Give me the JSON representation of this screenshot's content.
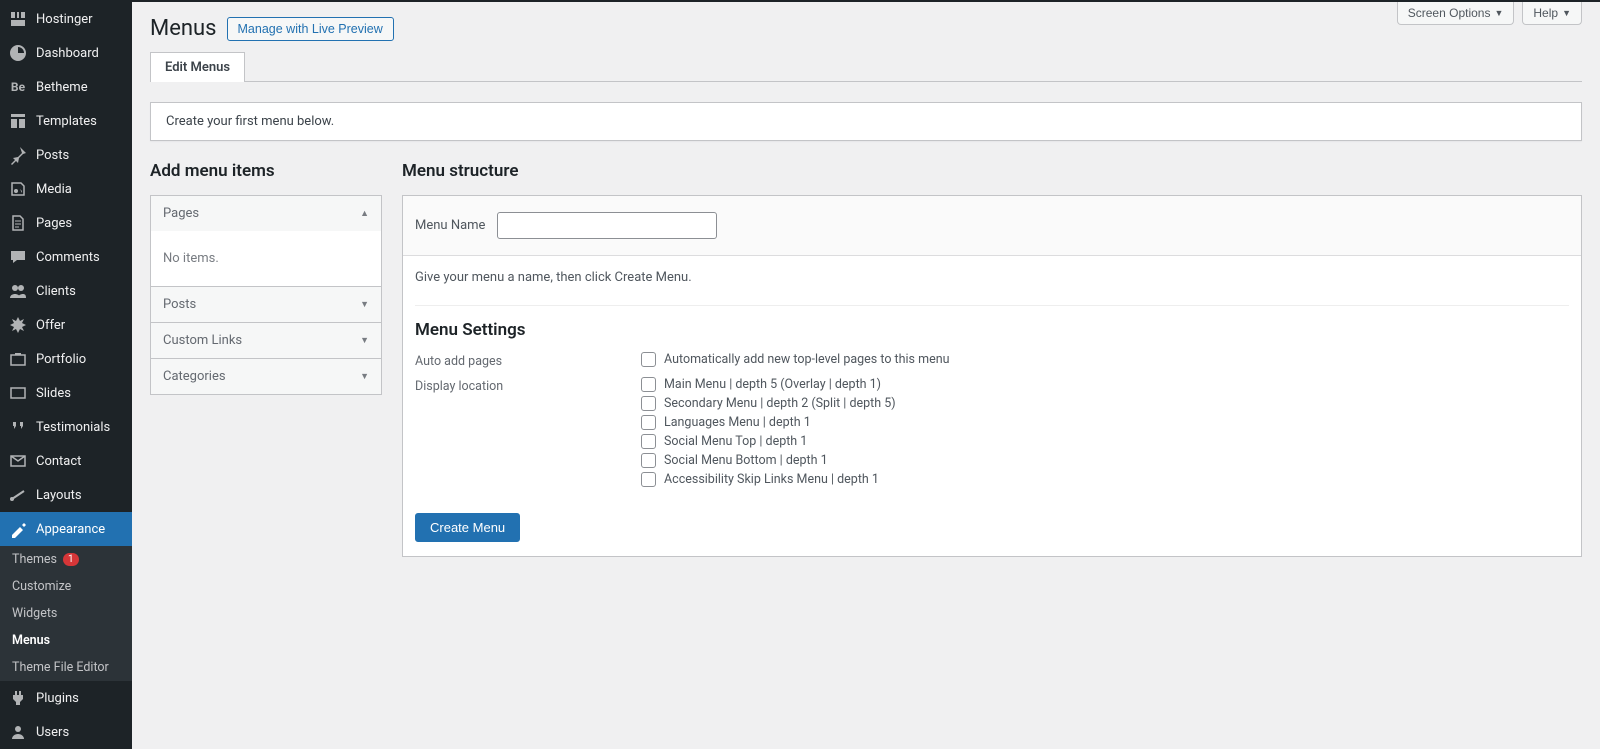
{
  "screen_options": [
    "Screen Options",
    "Help"
  ],
  "sidebar": [
    {
      "label": "Hostinger",
      "icon": "hostinger"
    },
    {
      "label": "Dashboard",
      "icon": "dashboard"
    },
    {
      "label": "Betheme",
      "icon": "betheme"
    },
    {
      "label": "Templates",
      "icon": "templates"
    },
    {
      "label": "Posts",
      "icon": "pin"
    },
    {
      "label": "Media",
      "icon": "media"
    },
    {
      "label": "Pages",
      "icon": "pages"
    },
    {
      "label": "Comments",
      "icon": "comments"
    },
    {
      "label": "Clients",
      "icon": "clients"
    },
    {
      "label": "Offer",
      "icon": "offer"
    },
    {
      "label": "Portfolio",
      "icon": "portfolio"
    },
    {
      "label": "Slides",
      "icon": "slides"
    },
    {
      "label": "Testimonials",
      "icon": "testimonials"
    },
    {
      "label": "Contact",
      "icon": "contact"
    },
    {
      "label": "Layouts",
      "icon": "layouts"
    },
    {
      "label": "Appearance",
      "icon": "appearance",
      "active": true
    },
    {
      "label": "Plugins",
      "icon": "plugins"
    },
    {
      "label": "Users",
      "icon": "users"
    }
  ],
  "submenu": [
    {
      "label": "Themes",
      "badge": "1"
    },
    {
      "label": "Customize"
    },
    {
      "label": "Widgets"
    },
    {
      "label": "Menus",
      "current": true
    },
    {
      "label": "Theme File Editor"
    }
  ],
  "page": {
    "title": "Menus",
    "preview_btn": "Manage with Live Preview",
    "tab": "Edit Menus",
    "notice": "Create your first menu below."
  },
  "left": {
    "heading": "Add menu items",
    "panels": [
      "Pages",
      "Posts",
      "Custom Links",
      "Categories"
    ],
    "no_items": "No items."
  },
  "right": {
    "heading": "Menu structure",
    "name_label": "Menu Name",
    "name_value": "",
    "hint": "Give your menu a name, then click Create Menu.",
    "settings_heading": "Menu Settings",
    "auto_label": "Auto add pages",
    "auto_option": "Automatically add new top-level pages to this menu",
    "display_label": "Display location",
    "locations": [
      "Main Menu | depth 5 (Overlay | depth 1)",
      "Secondary Menu | depth 2 (Split | depth 5)",
      "Languages Menu | depth 1",
      "Social Menu Top | depth 1",
      "Social Menu Bottom | depth 1",
      "Accessibility Skip Links Menu | depth 1"
    ],
    "create_btn": "Create Menu"
  }
}
